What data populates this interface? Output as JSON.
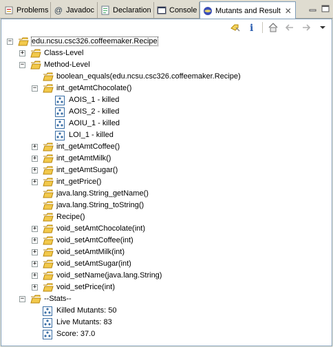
{
  "tabs": [
    {
      "label": "Problems",
      "icon": "problems-icon"
    },
    {
      "label": "Javadoc",
      "icon": "at-icon"
    },
    {
      "label": "Declaration",
      "icon": "declaration-icon"
    },
    {
      "label": "Console",
      "icon": "console-icon"
    },
    {
      "label": "Mutants and Result",
      "icon": "mutants-icon",
      "active": true
    }
  ],
  "tree": {
    "root": "edu.ncsu.csc326.coffeemaker.Recipe",
    "class_level": "Class-Level",
    "method_level": "Method-Level",
    "methods": [
      {
        "label": "boolean_equals(edu.ncsu.csc326.coffeemaker.Recipe)",
        "expander": "none"
      },
      {
        "label": "int_getAmtChocolate()",
        "expander": "minus"
      },
      {
        "label": "int_getAmtCoffee()",
        "expander": "plus"
      },
      {
        "label": "int_getAmtMilk()",
        "expander": "plus"
      },
      {
        "label": "int_getAmtSugar()",
        "expander": "plus"
      },
      {
        "label": "int_getPrice()",
        "expander": "plus"
      },
      {
        "label": "java.lang.String_getName()",
        "expander": "none"
      },
      {
        "label": "java.lang.String_toString()",
        "expander": "none"
      },
      {
        "label": "Recipe()",
        "expander": "none"
      },
      {
        "label": "void_setAmtChocolate(int)",
        "expander": "plus"
      },
      {
        "label": "void_setAmtCoffee(int)",
        "expander": "plus"
      },
      {
        "label": "void_setAmtMilk(int)",
        "expander": "plus"
      },
      {
        "label": "void_setAmtSugar(int)",
        "expander": "plus"
      },
      {
        "label": "void_setName(java.lang.String)",
        "expander": "plus"
      },
      {
        "label": "void_setPrice(int)",
        "expander": "plus"
      }
    ],
    "mutants": [
      "AOIS_1 - killed",
      "AOIS_2 - killed",
      "AOIU_1 - killed",
      "LOI_1 - killed"
    ],
    "stats_label": "--Stats--",
    "stats": [
      "Killed Mutants: 50",
      "Live Mutants: 83",
      "Score: 37.0"
    ]
  },
  "colors": {
    "folder": "#f2c94c",
    "folder_edge": "#b8860b",
    "mutant_icon": "#3a6ea5"
  }
}
